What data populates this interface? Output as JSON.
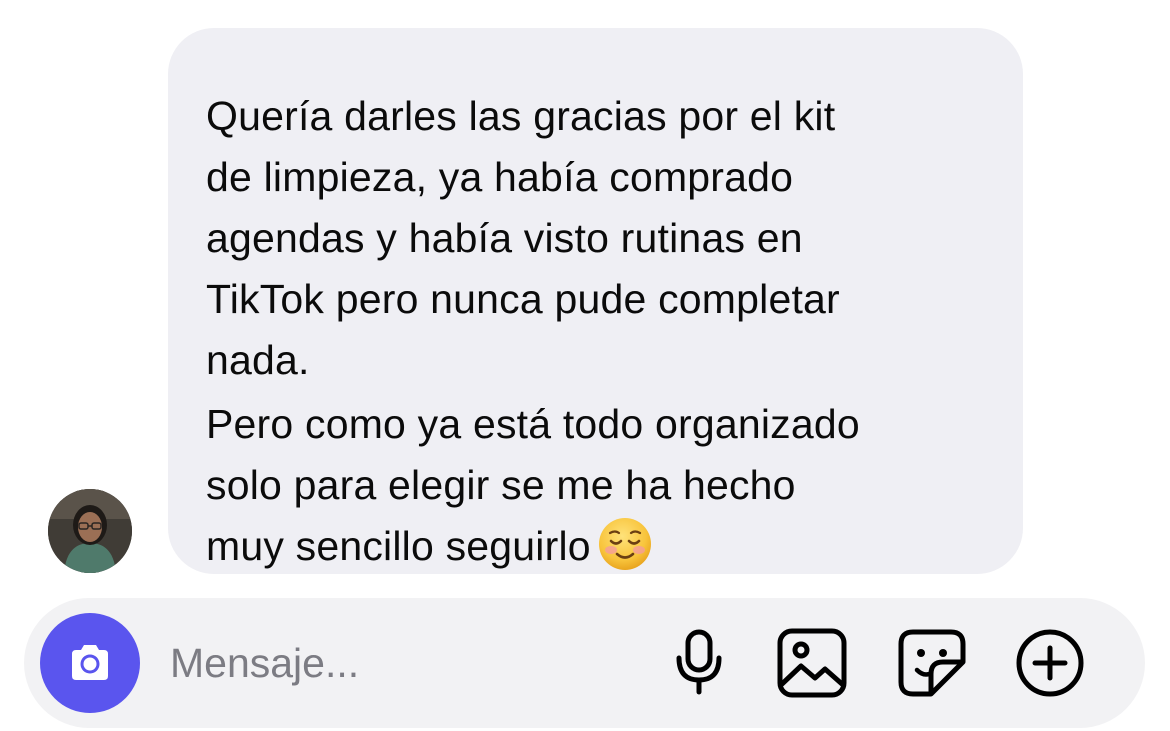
{
  "conversation": {
    "message": {
      "paragraph_1": "Quería darles las gracias por el kit\nde limpieza, ya había comprado\nagendas y había visto rutinas en\nTikTok pero nunca pude completar\nnada.",
      "paragraph_2": "Pero como ya está todo organizado\nsolo para elegir se me ha hecho\nmuy sencillo seguirlo",
      "emoji": "smiling-face-icon"
    },
    "sender_avatar": "avatar"
  },
  "composer": {
    "placeholder": "Mensaje...",
    "value": "",
    "icons": {
      "camera": "camera-icon",
      "voice": "microphone-icon",
      "gallery": "image-icon",
      "sticker": "sticker-icon",
      "more": "plus-circle-icon"
    }
  },
  "colors": {
    "accent": "#5a55ee",
    "bubble": "#efeff4",
    "composer": "#f2f2f4",
    "placeholder": "#7c7c83",
    "text": "#0b0b0b"
  }
}
